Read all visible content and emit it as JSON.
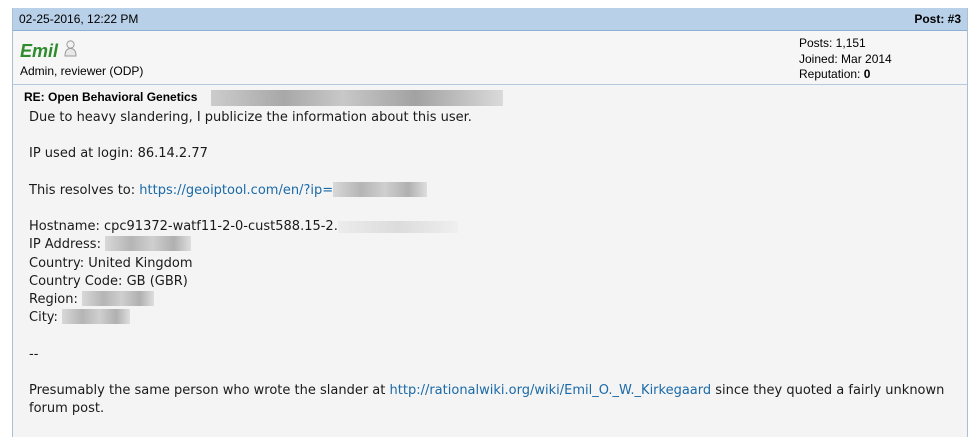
{
  "post": {
    "date": "02-25-2016, 12:22 PM",
    "number": "Post: #3"
  },
  "user": {
    "name": "Emil",
    "title": "Admin, reviewer (ODP)",
    "posts_label": "Posts: 1,151",
    "joined_label": "Joined: Mar 2014",
    "reputation_label": "Reputation:",
    "reputation_value": "0",
    "status_icon": "offline-user-icon"
  },
  "message": {
    "title": "RE: Open Behavioral Genetics",
    "line_intro": "Due to heavy slandering, I publicize the information about this user.",
    "line_ip": "IP used at login: 86.14.2.77",
    "resolves_label": "This resolves to: ",
    "resolves_link": "https://geoiptool.com/en/?ip=",
    "hostname": "Hostname: cpc91372-watf11-2-0-cust588.15-2.",
    "ip_address_label": "IP Address: ",
    "country": "Country: United Kingdom",
    "country_code": "Country Code: GB (GBR)",
    "region_label": "Region: ",
    "city_label": "City: ",
    "separator": "--",
    "presumably_text": "Presumably the same person who wrote the slander at ",
    "rationalwiki_link": "http://rationalwiki.org/wiki/Emil_O._W._Kirkegaard",
    "presumably_tail": " since they quoted a fairly unknown forum post."
  },
  "colors": {
    "header_bg": "#b8d0e8",
    "username": "#2e8b2e",
    "link": "#1a6aa8"
  }
}
